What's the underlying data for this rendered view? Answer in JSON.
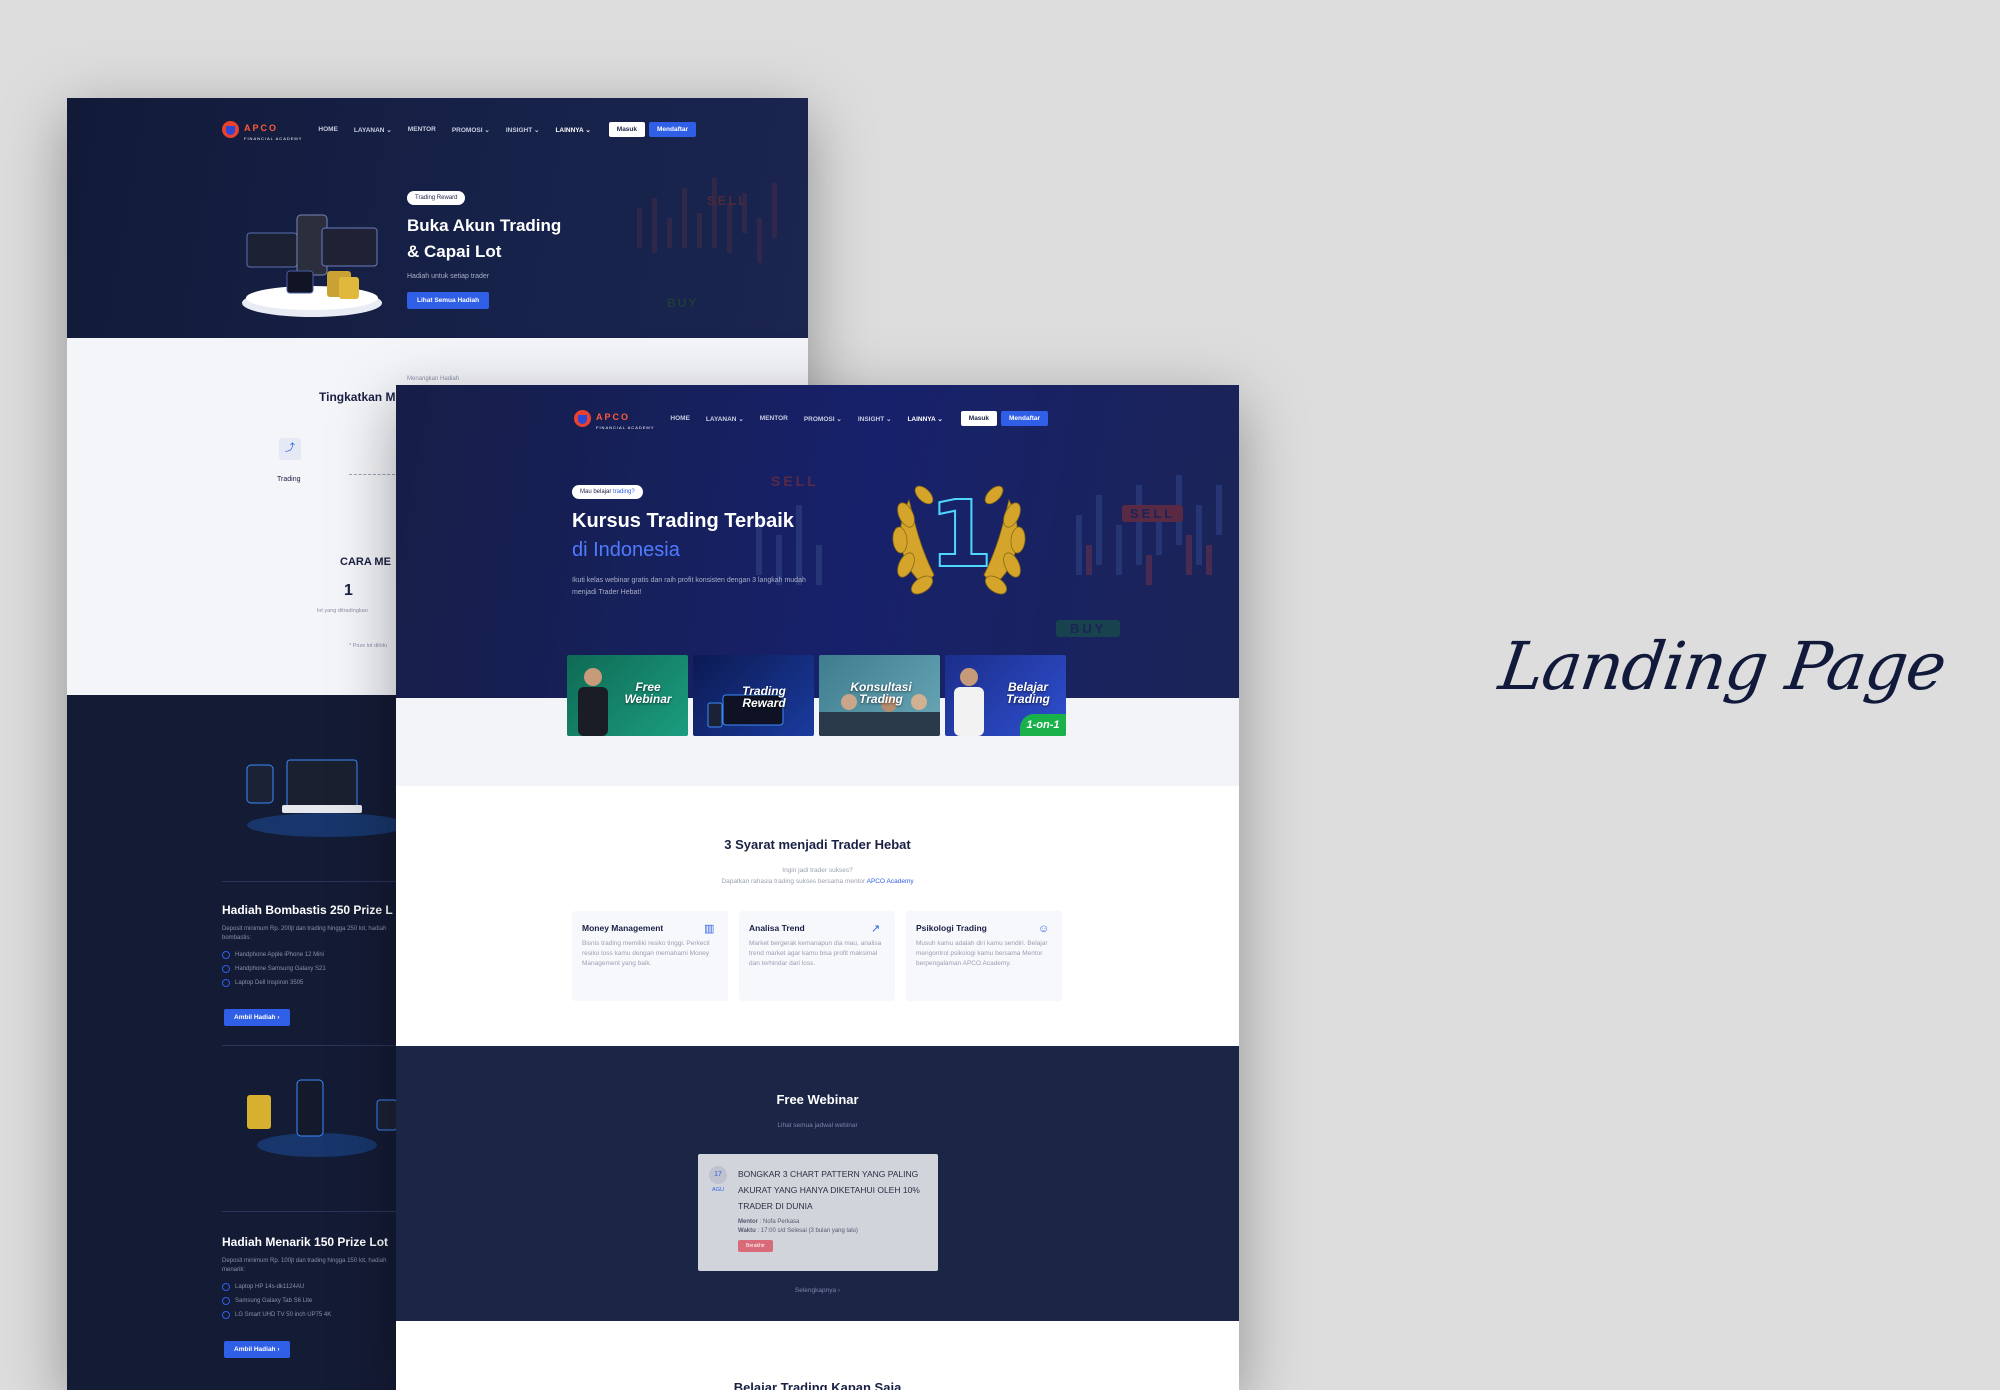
{
  "label": "Landing Page",
  "colors": {
    "navy": "#17224a",
    "accent": "#2f5fe6",
    "page_bg": "#dddddd"
  },
  "nav": {
    "logo": "APCO",
    "logo_sub": "FINANCIAL ACADEMY",
    "items": [
      "HOME",
      "LAYANAN",
      "MENTOR",
      "PROMOSI",
      "INSIGHT",
      "LAINNYA"
    ],
    "masuk": "Masuk",
    "mendaftar": "Mendaftar"
  },
  "back": {
    "hero": {
      "pill": "Trading Reward",
      "title_1": "Buka Akun Trading",
      "title_2": "& Capai Lot",
      "subtitle": "Hadiah untuk setiap trader",
      "button": "Lihat Semua Hadiah"
    },
    "bg_sell": "SELL",
    "bg_buy": "BUY",
    "section_title": "Tingkatkan M",
    "section_note": "Menangkan Hadiah",
    "step_label": "Trading",
    "cara_title": "CARA ME",
    "cara_number": "1",
    "cara_caption": "lot yang ditradingkan",
    "footnote": "* Prize lot dihitu",
    "prize1": {
      "title": "Hadiah Bombastis 250 Prize L",
      "desc": "Deposit minimum Rp. 200jt dan trading hingga 250 lot, hadiah bombastis:",
      "items": [
        "Handphone Apple iPhone 12 Mini",
        "Handphone Samsung Galaxy S21",
        "Laptop Dell Inspiron 3505"
      ],
      "button": "Ambil Hadiah"
    },
    "prize2": {
      "title": "Hadiah Menarik 150 Prize Lot",
      "desc": "Deposit minimum Rp. 100jt dan trading hingga 150 lot, hadiah menarik:",
      "items": [
        "Laptop HP 14s-dk1124AU",
        "Samsung Galaxy Tab S6 Lite",
        "LG Smart UHD TV 50 inch UP75 4K"
      ],
      "button": "Ambil Hadiah"
    }
  },
  "front": {
    "hero": {
      "pill_prefix": "Mau belajar ",
      "pill_link": "trading?",
      "title_1": "Kursus Trading Terbaik",
      "title_2": "di Indonesia",
      "desc": "Ikuti kelas webinar gratis dan raih profit konsisten dengan 3 langkah mudah menjadi Trader Hebat!",
      "award_number": "1",
      "sell_1": "SELL",
      "sell_2": "SELL",
      "buy": "BUY"
    },
    "cards": [
      {
        "label": "Free Webinar"
      },
      {
        "label": "Trading Reward"
      },
      {
        "label": "Konsultasi Trading"
      },
      {
        "label": "Belajar Trading",
        "badge": "1-on-1"
      }
    ],
    "syarat": {
      "title": "3 Syarat menjadi Trader Hebat",
      "sub_1": "Ingin jadi trader sukses?",
      "sub_2_prefix": "Dapatkan rahasia trading sukses bersama mentor ",
      "sub_2_link": "APCO Academy",
      "features": [
        {
          "title": "Money Management",
          "icon": "coins-icon",
          "text": "Bisnis trading memiliki resiko tinggi. Perkecil resiko loss kamu dengan memahami Money Management yang baik."
        },
        {
          "title": "Analisa Trend",
          "icon": "trend-icon",
          "text": "Market bergerak kemanapun dia mau, analisa trend market agar kamu bisa profit maksimal dan terhindar dari loss."
        },
        {
          "title": "Psikologi Trading",
          "icon": "smile-icon",
          "text": "Musuh kamu adalah diri kamu sendiri. Belajar mengontrol psikologi kamu bersama Mentor berpengalaman APCO Academy."
        }
      ]
    },
    "webinar": {
      "title": "Free Webinar",
      "subtitle": "Lihat semua jadwal webinar",
      "date_day": "17",
      "date_month": "AGU",
      "event_title": "BONGKAR 3 CHART PATTERN YANG PALING AKURAT YANG HANYA DIKETAHUI OLEH 10% TRADER DI DUNIA",
      "mentor_label": "Mentor",
      "mentor": "Nofa Perkasa",
      "time_label": "Waktu",
      "time": "17:00 s/d Selesai (3 bulan yang lalu)",
      "status": "Berakhir",
      "more": "Selengkapnya ›"
    },
    "next_section": "Belajar Trading Kapan Saja"
  }
}
